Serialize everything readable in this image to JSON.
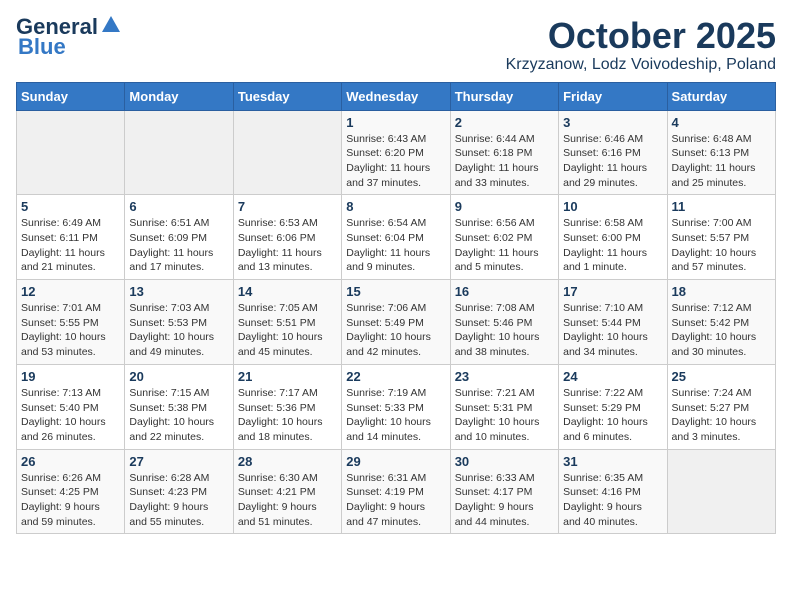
{
  "header": {
    "logo_line1": "General",
    "logo_line2": "Blue",
    "month": "October 2025",
    "location": "Krzyzanow, Lodz Voivodeship, Poland"
  },
  "weekdays": [
    "Sunday",
    "Monday",
    "Tuesday",
    "Wednesday",
    "Thursday",
    "Friday",
    "Saturday"
  ],
  "weeks": [
    [
      {
        "day": "",
        "info": ""
      },
      {
        "day": "",
        "info": ""
      },
      {
        "day": "",
        "info": ""
      },
      {
        "day": "1",
        "info": "Sunrise: 6:43 AM\nSunset: 6:20 PM\nDaylight: 11 hours\nand 37 minutes."
      },
      {
        "day": "2",
        "info": "Sunrise: 6:44 AM\nSunset: 6:18 PM\nDaylight: 11 hours\nand 33 minutes."
      },
      {
        "day": "3",
        "info": "Sunrise: 6:46 AM\nSunset: 6:16 PM\nDaylight: 11 hours\nand 29 minutes."
      },
      {
        "day": "4",
        "info": "Sunrise: 6:48 AM\nSunset: 6:13 PM\nDaylight: 11 hours\nand 25 minutes."
      }
    ],
    [
      {
        "day": "5",
        "info": "Sunrise: 6:49 AM\nSunset: 6:11 PM\nDaylight: 11 hours\nand 21 minutes."
      },
      {
        "day": "6",
        "info": "Sunrise: 6:51 AM\nSunset: 6:09 PM\nDaylight: 11 hours\nand 17 minutes."
      },
      {
        "day": "7",
        "info": "Sunrise: 6:53 AM\nSunset: 6:06 PM\nDaylight: 11 hours\nand 13 minutes."
      },
      {
        "day": "8",
        "info": "Sunrise: 6:54 AM\nSunset: 6:04 PM\nDaylight: 11 hours\nand 9 minutes."
      },
      {
        "day": "9",
        "info": "Sunrise: 6:56 AM\nSunset: 6:02 PM\nDaylight: 11 hours\nand 5 minutes."
      },
      {
        "day": "10",
        "info": "Sunrise: 6:58 AM\nSunset: 6:00 PM\nDaylight: 11 hours\nand 1 minute."
      },
      {
        "day": "11",
        "info": "Sunrise: 7:00 AM\nSunset: 5:57 PM\nDaylight: 10 hours\nand 57 minutes."
      }
    ],
    [
      {
        "day": "12",
        "info": "Sunrise: 7:01 AM\nSunset: 5:55 PM\nDaylight: 10 hours\nand 53 minutes."
      },
      {
        "day": "13",
        "info": "Sunrise: 7:03 AM\nSunset: 5:53 PM\nDaylight: 10 hours\nand 49 minutes."
      },
      {
        "day": "14",
        "info": "Sunrise: 7:05 AM\nSunset: 5:51 PM\nDaylight: 10 hours\nand 45 minutes."
      },
      {
        "day": "15",
        "info": "Sunrise: 7:06 AM\nSunset: 5:49 PM\nDaylight: 10 hours\nand 42 minutes."
      },
      {
        "day": "16",
        "info": "Sunrise: 7:08 AM\nSunset: 5:46 PM\nDaylight: 10 hours\nand 38 minutes."
      },
      {
        "day": "17",
        "info": "Sunrise: 7:10 AM\nSunset: 5:44 PM\nDaylight: 10 hours\nand 34 minutes."
      },
      {
        "day": "18",
        "info": "Sunrise: 7:12 AM\nSunset: 5:42 PM\nDaylight: 10 hours\nand 30 minutes."
      }
    ],
    [
      {
        "day": "19",
        "info": "Sunrise: 7:13 AM\nSunset: 5:40 PM\nDaylight: 10 hours\nand 26 minutes."
      },
      {
        "day": "20",
        "info": "Sunrise: 7:15 AM\nSunset: 5:38 PM\nDaylight: 10 hours\nand 22 minutes."
      },
      {
        "day": "21",
        "info": "Sunrise: 7:17 AM\nSunset: 5:36 PM\nDaylight: 10 hours\nand 18 minutes."
      },
      {
        "day": "22",
        "info": "Sunrise: 7:19 AM\nSunset: 5:33 PM\nDaylight: 10 hours\nand 14 minutes."
      },
      {
        "day": "23",
        "info": "Sunrise: 7:21 AM\nSunset: 5:31 PM\nDaylight: 10 hours\nand 10 minutes."
      },
      {
        "day": "24",
        "info": "Sunrise: 7:22 AM\nSunset: 5:29 PM\nDaylight: 10 hours\nand 6 minutes."
      },
      {
        "day": "25",
        "info": "Sunrise: 7:24 AM\nSunset: 5:27 PM\nDaylight: 10 hours\nand 3 minutes."
      }
    ],
    [
      {
        "day": "26",
        "info": "Sunrise: 6:26 AM\nSunset: 4:25 PM\nDaylight: 9 hours\nand 59 minutes."
      },
      {
        "day": "27",
        "info": "Sunrise: 6:28 AM\nSunset: 4:23 PM\nDaylight: 9 hours\nand 55 minutes."
      },
      {
        "day": "28",
        "info": "Sunrise: 6:30 AM\nSunset: 4:21 PM\nDaylight: 9 hours\nand 51 minutes."
      },
      {
        "day": "29",
        "info": "Sunrise: 6:31 AM\nSunset: 4:19 PM\nDaylight: 9 hours\nand 47 minutes."
      },
      {
        "day": "30",
        "info": "Sunrise: 6:33 AM\nSunset: 4:17 PM\nDaylight: 9 hours\nand 44 minutes."
      },
      {
        "day": "31",
        "info": "Sunrise: 6:35 AM\nSunset: 4:16 PM\nDaylight: 9 hours\nand 40 minutes."
      },
      {
        "day": "",
        "info": ""
      }
    ]
  ]
}
